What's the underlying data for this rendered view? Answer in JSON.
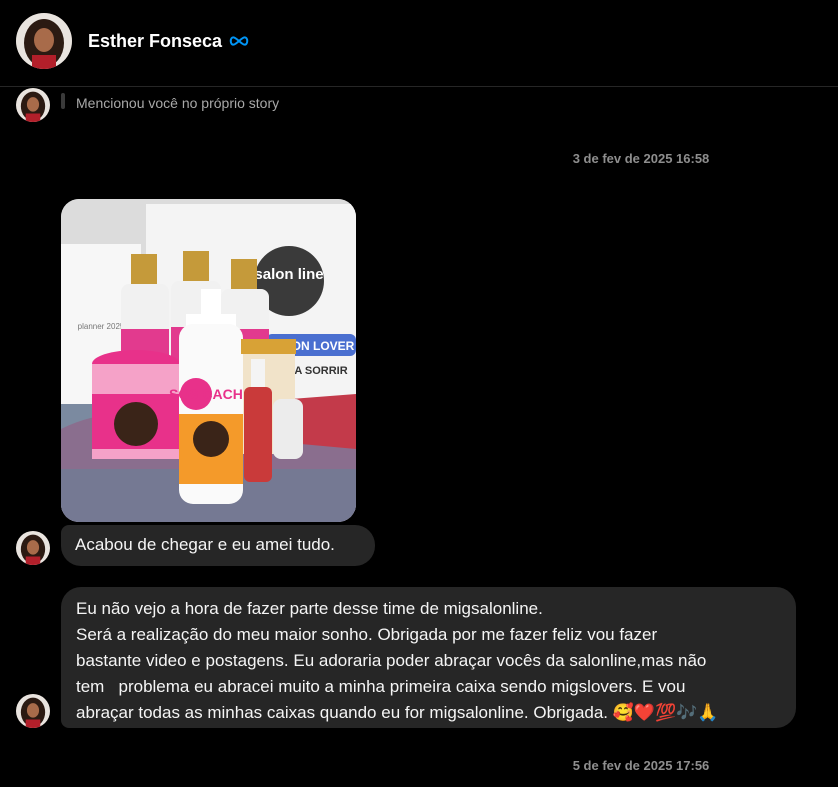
{
  "header": {
    "contact_name": "Esther Fonseca",
    "verified_icon": "infinity-icon",
    "accent_color": "#0095f6"
  },
  "story_mention": {
    "text": "Mencionou você no próprio story"
  },
  "timestamps": [
    "3 de fev de 2025 16:58",
    "5 de fev de 2025 17:56"
  ],
  "messages": [
    {
      "type": "image",
      "description_icon": "photo-attachment"
    },
    {
      "type": "text",
      "text": "Acabou de chegar e eu amei tudo."
    },
    {
      "type": "text",
      "lines": [
        "Eu não vejo a hora de fazer parte desse time de migsalonline.",
        "Será a realização do meu maior sonho. Obrigada por me fazer feliz vou fazer",
        "bastante video e postagens. Eu adoraria poder abraçar vocês da salonline,mas não",
        "tem   problema eu abracei muito a minha primeira caixa sendo migslovers. E vou",
        "abraçar todas as minhas caixas quando eu for migsalonline. Obrigada. 🥰❤️💯🎶🙏"
      ]
    }
  ],
  "photo_text": {
    "brand": "salon line",
    "box_banner": "SALON LOVER",
    "box_sub": "A SORRIR",
    "planner": "planner 2025",
    "product": "SOS CACHOS"
  }
}
